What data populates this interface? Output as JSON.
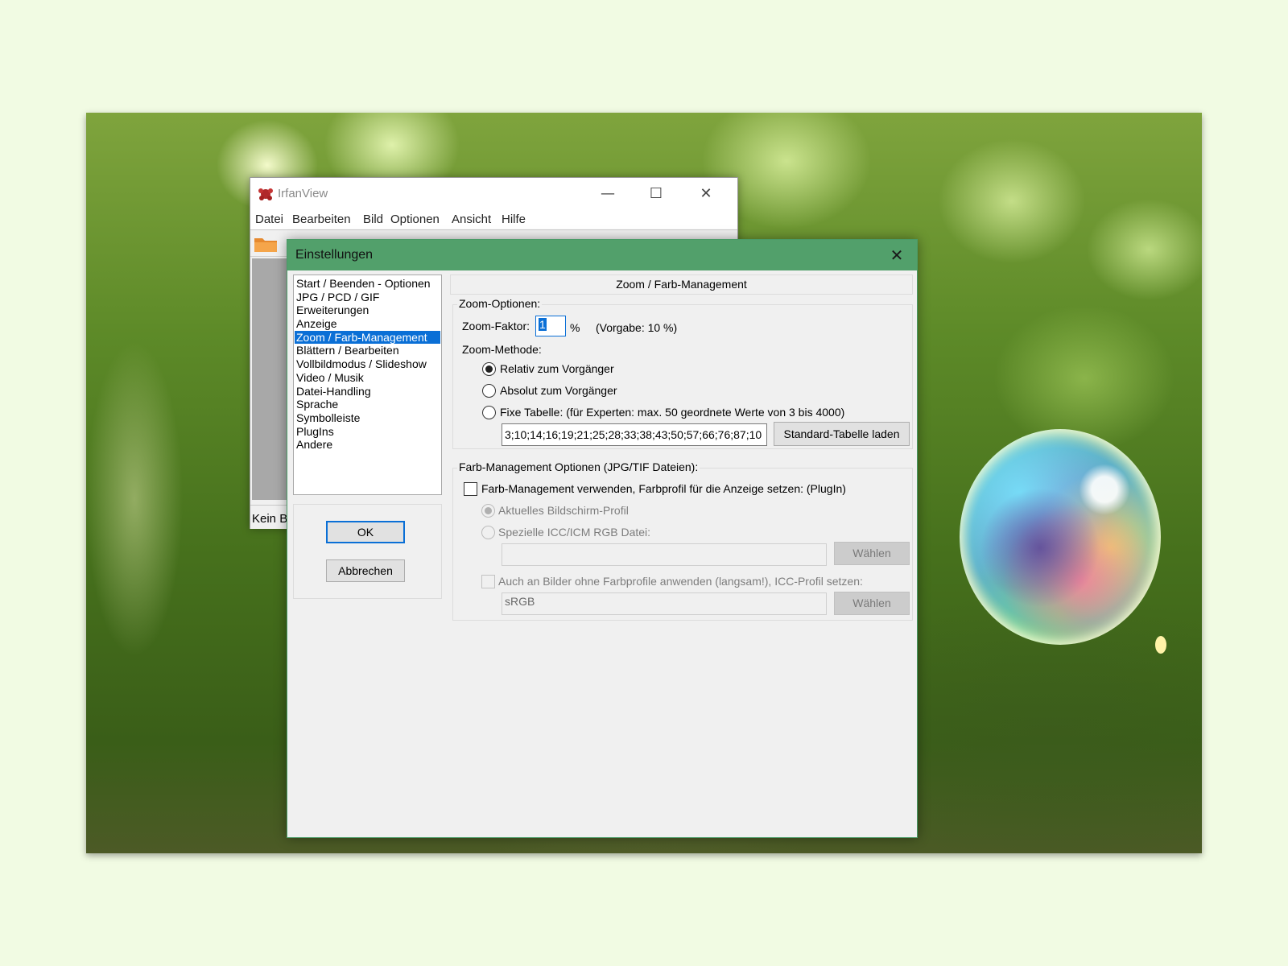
{
  "main_window": {
    "title": "IrfanView",
    "menu": [
      "Datei",
      "Bearbeiten",
      "Bild",
      "Optionen",
      "Ansicht",
      "Hilfe"
    ],
    "status_text": "Kein B"
  },
  "dialog": {
    "title": "Einstellungen",
    "categories": [
      "Start / Beenden - Optionen",
      "JPG / PCD / GIF",
      "Erweiterungen",
      "Anzeige",
      "Zoom / Farb-Management",
      "Blättern / Bearbeiten",
      "Vollbildmodus / Slideshow",
      "Video / Musik",
      "Datei-Handling",
      "Sprache",
      "Symbolleiste",
      "PlugIns",
      "Andere"
    ],
    "selected_category": "Zoom / Farb-Management",
    "ok_label": "OK",
    "cancel_label": "Abbrechen",
    "page_title": "Zoom / Farb-Management",
    "zoom_options": {
      "group_label": "Zoom-Optionen:",
      "factor_label": "Zoom-Faktor:",
      "factor_value": "1",
      "percent_sign": "%",
      "default_hint": "(Vorgabe: 10 %)",
      "method_label": "Zoom-Methode:",
      "radio_relative": "Relativ zum Vorgänger",
      "radio_absolute": "Absolut zum Vorgänger",
      "radio_fixed": "Fixe Tabelle: (für Experten: max. 50 geordnete Werte von 3 bis 4000)",
      "selected_method": "relative",
      "table_value": "3;10;14;16;19;21;25;28;33;38;43;50;57;66;76;87;10",
      "load_table_label": "Standard-Tabelle laden"
    },
    "color_management": {
      "group_label": "Farb-Management Optionen (JPG/TIF Dateien):",
      "enable_label": "Farb-Management verwenden, Farbprofil für die Anzeige setzen: (PlugIn)",
      "enabled": false,
      "radio_screen_profile": "Aktuelles Bildschirm-Profil",
      "radio_icc_file": "Spezielle ICC/ICM RGB Datei:",
      "icc_path_value": "",
      "choose_label": "Wählen",
      "apply_all_label": "Auch an Bilder ohne Farbprofile anwenden (langsam!), ICC-Profil setzen:",
      "profile_value": "sRGB",
      "choose_label_2": "Wählen"
    }
  },
  "colors": {
    "dialog_titlebar": "#52a06b",
    "selection": "#0a6fd6",
    "page_background": "#f1fbe3"
  }
}
